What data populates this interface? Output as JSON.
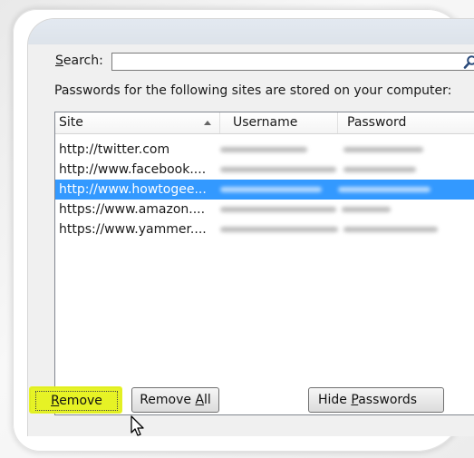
{
  "search": {
    "label_first": "S",
    "label_rest": "earch:",
    "value": ""
  },
  "info_text": "Passwords for the following sites are stored on your computer:",
  "columns": {
    "site": "Site",
    "username": "Username",
    "password": "Password"
  },
  "rows": [
    {
      "site": "http://twitter.com",
      "selected": false
    },
    {
      "site": "http://www.facebook....",
      "selected": false
    },
    {
      "site": "http://www.howtogee...",
      "selected": true
    },
    {
      "site": "https://www.amazon....",
      "selected": false
    },
    {
      "site": "https://www.yammer....",
      "selected": false
    }
  ],
  "buttons": {
    "remove_first": "R",
    "remove_rest": "emove",
    "removeall_prefix": "Remove ",
    "removeall_key": "A",
    "removeall_rest": "ll",
    "hide_prefix": "Hide ",
    "hide_key": "P",
    "hide_rest": "asswords"
  },
  "colors": {
    "selection": "#3399ff",
    "highlight": "#e6f21a"
  },
  "icons": [
    "search-icon",
    "sort-ascending-icon",
    "mouse-pointer-icon"
  ]
}
